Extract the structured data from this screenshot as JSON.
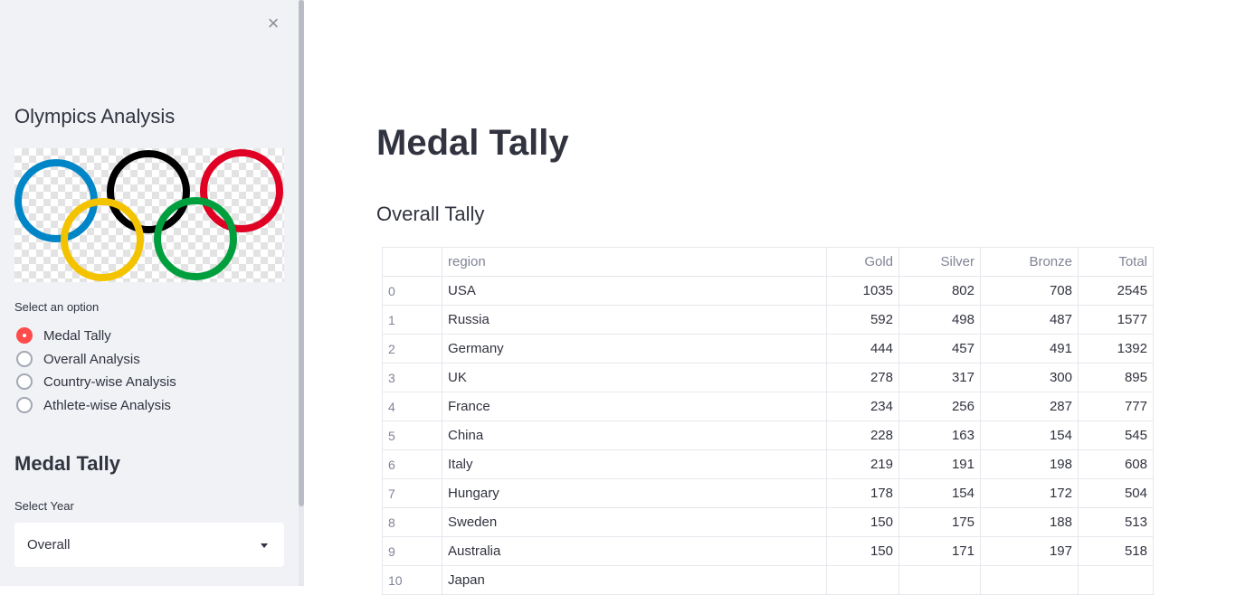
{
  "sidebar": {
    "title": "Olympics Analysis",
    "select_label": "Select an option",
    "options": [
      "Medal Tally",
      "Overall Analysis",
      "Country-wise Analysis",
      "Athlete-wise Analysis"
    ],
    "selected_option": "Medal Tally",
    "section_title": "Medal Tally",
    "year_label": "Select Year",
    "year_value": "Overall",
    "close_icon": "×"
  },
  "main": {
    "title": "Medal Tally",
    "subtitle": "Overall Tally",
    "table": {
      "columns": [
        "",
        "region",
        "Gold",
        "Silver",
        "Bronze",
        "Total"
      ],
      "rows": [
        [
          "0",
          "USA",
          "1035",
          "802",
          "708",
          "2545"
        ],
        [
          "1",
          "Russia",
          "592",
          "498",
          "487",
          "1577"
        ],
        [
          "2",
          "Germany",
          "444",
          "457",
          "491",
          "1392"
        ],
        [
          "3",
          "UK",
          "278",
          "317",
          "300",
          "895"
        ],
        [
          "4",
          "France",
          "234",
          "256",
          "287",
          "777"
        ],
        [
          "5",
          "China",
          "228",
          "163",
          "154",
          "545"
        ],
        [
          "6",
          "Italy",
          "219",
          "191",
          "198",
          "608"
        ],
        [
          "7",
          "Hungary",
          "178",
          "154",
          "172",
          "504"
        ],
        [
          "8",
          "Sweden",
          "150",
          "175",
          "188",
          "513"
        ],
        [
          "9",
          "Australia",
          "150",
          "171",
          "197",
          "518"
        ],
        [
          "10",
          "Japan",
          "",
          "",
          "",
          ""
        ]
      ]
    }
  },
  "colors": {
    "accent": "#ff4b4b",
    "sidebar_bg": "#f0f2f6",
    "ring_blue": "#0085c7",
    "ring_yellow": "#f4c300",
    "ring_black": "#000000",
    "ring_green": "#009f3d",
    "ring_red": "#df0024"
  }
}
